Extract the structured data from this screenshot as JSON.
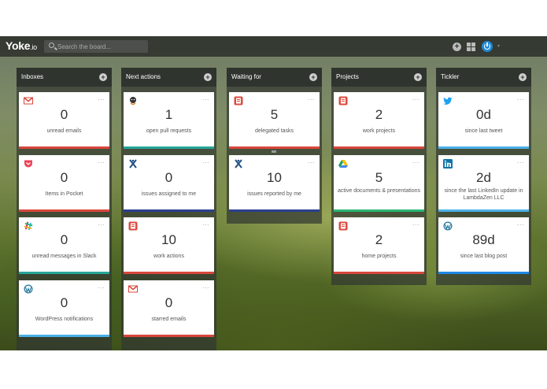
{
  "app": {
    "logo_main": "Yoke",
    "logo_suffix": ".io"
  },
  "search": {
    "placeholder": "Search the board..."
  },
  "columns": [
    {
      "title": "Inboxes",
      "cards": [
        {
          "icon": "gmail-icon",
          "value": "0",
          "caption": "unread emails"
        },
        {
          "icon": "pocket-icon",
          "value": "0",
          "caption": "Items in Pocket"
        },
        {
          "icon": "slack-icon",
          "value": "0",
          "caption": "unread messages in Slack"
        },
        {
          "icon": "wordpress-icon",
          "value": "0",
          "caption": "WordPress notifications"
        }
      ]
    },
    {
      "title": "Next actions",
      "cards": [
        {
          "icon": "github-icon",
          "value": "1",
          "caption": "open pull requests"
        },
        {
          "icon": "jira-icon",
          "value": "0",
          "caption": "issues assigned to me"
        },
        {
          "icon": "todoist-icon",
          "value": "10",
          "caption": "work actions"
        },
        {
          "icon": "gmail-icon",
          "value": "0",
          "caption": "starred emails"
        }
      ]
    },
    {
      "title": "Waiting for",
      "cards": [
        {
          "icon": "todoist-icon",
          "value": "5",
          "caption": "delegated tasks"
        },
        {
          "icon": "jira-icon",
          "value": "10",
          "caption": "issues reported by me"
        }
      ]
    },
    {
      "title": "Projects",
      "cards": [
        {
          "icon": "todoist-icon",
          "value": "2",
          "caption": "work projects"
        },
        {
          "icon": "google-drive-icon",
          "value": "5",
          "caption": "active documents & presentations"
        },
        {
          "icon": "todoist-icon",
          "value": "2",
          "caption": "home projects"
        }
      ]
    },
    {
      "title": "Tickler",
      "cards": [
        {
          "icon": "twitter-icon",
          "value": "0d",
          "caption": "since last tweet"
        },
        {
          "icon": "linkedin-icon",
          "value": "2d",
          "caption": "since the last LinkedIn update in LambdaZen LLC"
        },
        {
          "icon": "wordpress-icon",
          "value": "89d",
          "caption": "since last blog post"
        }
      ]
    }
  ],
  "card_menu": "...",
  "add_symbol": "+",
  "colors": {
    "topbar": "#2c302c",
    "accent_blue": "#1e8ad6",
    "gmail_red": "#d9473b",
    "todoist_red": "#db4c3f"
  }
}
